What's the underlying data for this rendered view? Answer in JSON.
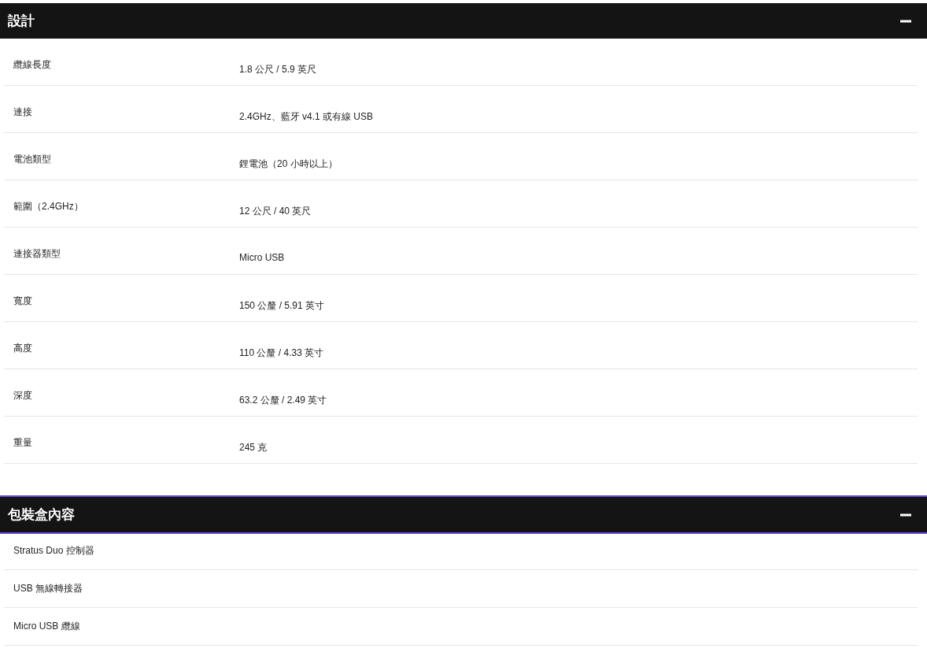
{
  "sections": [
    {
      "title": "設計",
      "expanded": true,
      "focused": false,
      "kind": "specs",
      "rows": [
        {
          "label": "纜線長度",
          "value": "1.8 公尺 / 5.9 英尺"
        },
        {
          "label": "連接",
          "value": "2.4GHz、藍牙 v4.1 或有線 USB"
        },
        {
          "label": "電池類型",
          "value": "鋰電池（20 小時以上）"
        },
        {
          "label": "範圍（2.4GHz）",
          "value": "12 公尺 / 40 英尺"
        },
        {
          "label": "連接器類型",
          "value": "Micro USB"
        },
        {
          "label": "寬度",
          "value": "150 公釐 / 5.91 英寸"
        },
        {
          "label": "高度",
          "value": "110 公釐 / 4.33 英寸"
        },
        {
          "label": "深度",
          "value": "63.2 公釐 / 2.49 英寸"
        },
        {
          "label": "重量",
          "value": "245 克"
        }
      ]
    },
    {
      "title": "包裝盒內容",
      "expanded": true,
      "focused": true,
      "kind": "list",
      "items": [
        "Stratus Duo 控制器",
        "USB 無線轉接器",
        "Micro USB 纜線"
      ]
    }
  ]
}
